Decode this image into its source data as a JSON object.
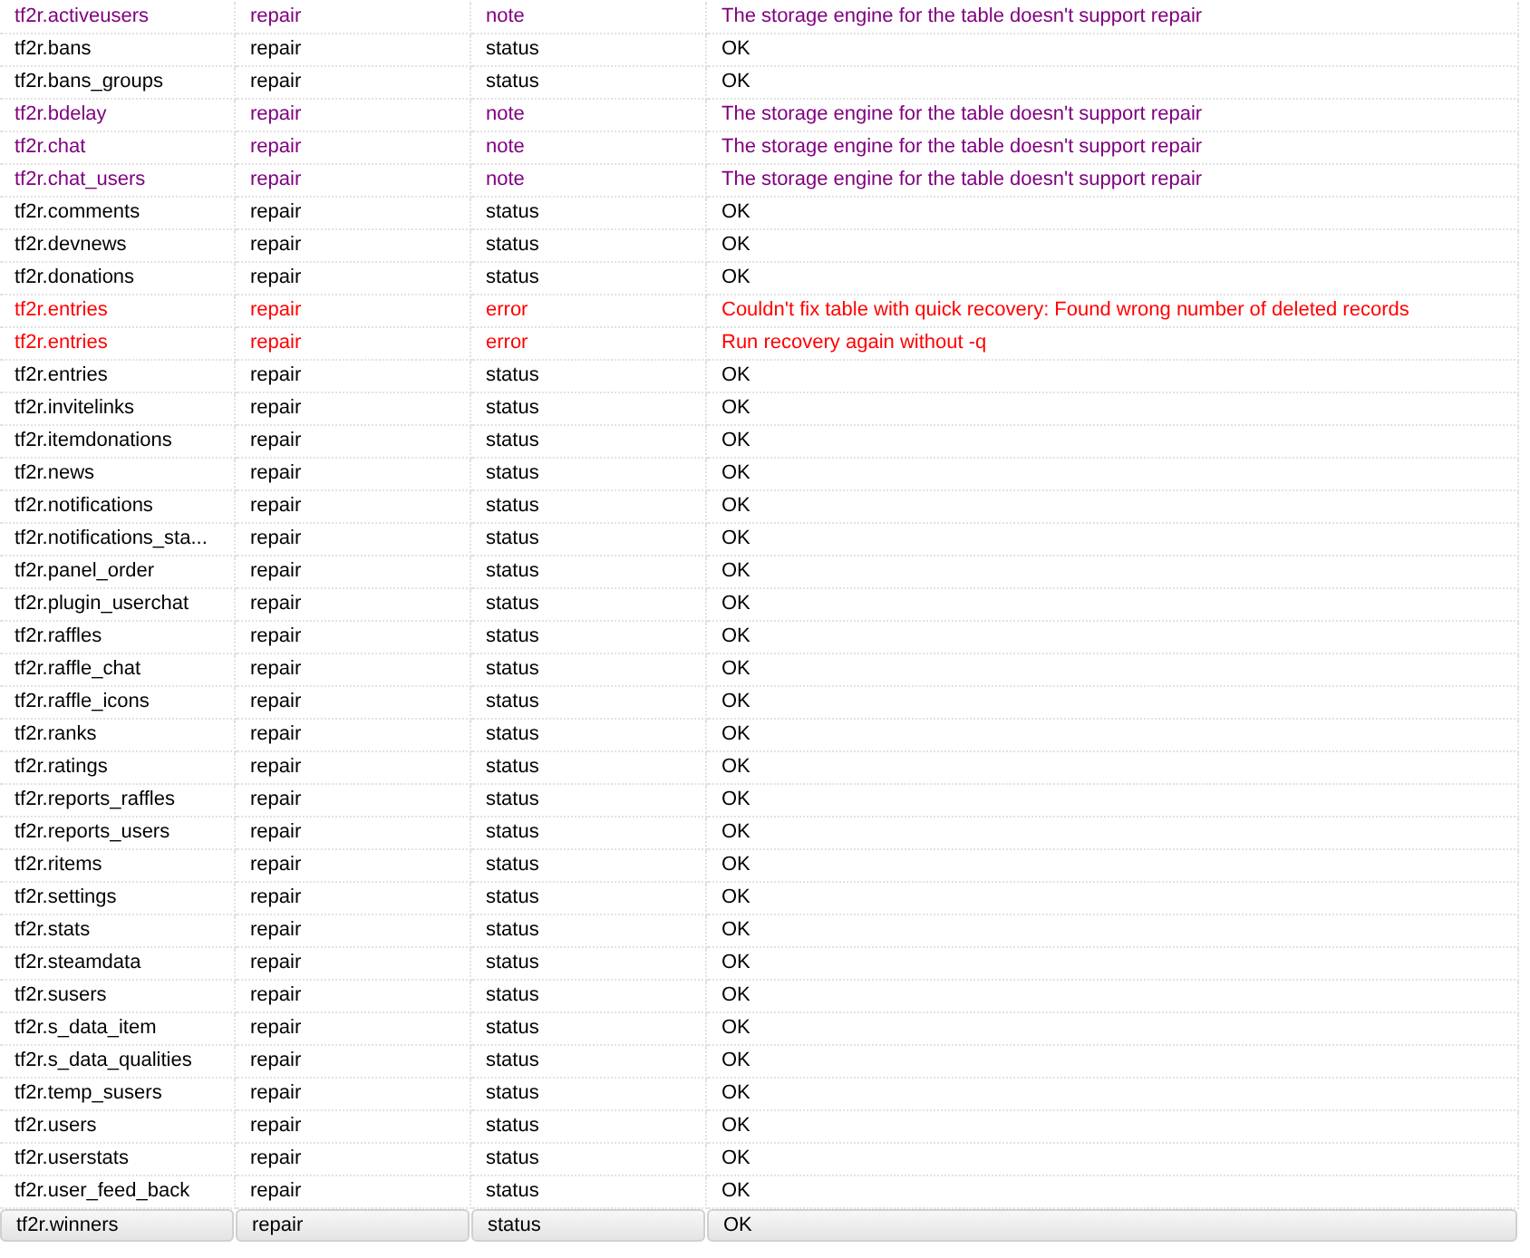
{
  "table": {
    "rows": [
      {
        "kind": "note",
        "selected": false,
        "cells": [
          "tf2r.activeusers",
          "repair",
          "note",
          "The storage engine for the table doesn't support repair"
        ]
      },
      {
        "kind": "status",
        "selected": false,
        "cells": [
          "tf2r.bans",
          "repair",
          "status",
          "OK"
        ]
      },
      {
        "kind": "status",
        "selected": false,
        "cells": [
          "tf2r.bans_groups",
          "repair",
          "status",
          "OK"
        ]
      },
      {
        "kind": "note",
        "selected": false,
        "cells": [
          "tf2r.bdelay",
          "repair",
          "note",
          "The storage engine for the table doesn't support repair"
        ]
      },
      {
        "kind": "note",
        "selected": false,
        "cells": [
          "tf2r.chat",
          "repair",
          "note",
          "The storage engine for the table doesn't support repair"
        ]
      },
      {
        "kind": "note",
        "selected": false,
        "cells": [
          "tf2r.chat_users",
          "repair",
          "note",
          "The storage engine for the table doesn't support repair"
        ]
      },
      {
        "kind": "status",
        "selected": false,
        "cells": [
          "tf2r.comments",
          "repair",
          "status",
          "OK"
        ]
      },
      {
        "kind": "status",
        "selected": false,
        "cells": [
          "tf2r.devnews",
          "repair",
          "status",
          "OK"
        ]
      },
      {
        "kind": "status",
        "selected": false,
        "cells": [
          "tf2r.donations",
          "repair",
          "status",
          "OK"
        ]
      },
      {
        "kind": "error",
        "selected": false,
        "cells": [
          "tf2r.entries",
          "repair",
          "error",
          "Couldn't fix table with quick recovery: Found wrong number of deleted records"
        ]
      },
      {
        "kind": "error",
        "selected": false,
        "cells": [
          "tf2r.entries",
          "repair",
          "error",
          "Run recovery again without -q"
        ]
      },
      {
        "kind": "status",
        "selected": false,
        "cells": [
          "tf2r.entries",
          "repair",
          "status",
          "OK"
        ]
      },
      {
        "kind": "status",
        "selected": false,
        "cells": [
          "tf2r.invitelinks",
          "repair",
          "status",
          "OK"
        ]
      },
      {
        "kind": "status",
        "selected": false,
        "cells": [
          "tf2r.itemdonations",
          "repair",
          "status",
          "OK"
        ]
      },
      {
        "kind": "status",
        "selected": false,
        "cells": [
          "tf2r.news",
          "repair",
          "status",
          "OK"
        ]
      },
      {
        "kind": "status",
        "selected": false,
        "cells": [
          "tf2r.notifications",
          "repair",
          "status",
          "OK"
        ]
      },
      {
        "kind": "status",
        "selected": false,
        "cells": [
          "tf2r.notifications_sta...",
          "repair",
          "status",
          "OK"
        ]
      },
      {
        "kind": "status",
        "selected": false,
        "cells": [
          "tf2r.panel_order",
          "repair",
          "status",
          "OK"
        ]
      },
      {
        "kind": "status",
        "selected": false,
        "cells": [
          "tf2r.plugin_userchat",
          "repair",
          "status",
          "OK"
        ]
      },
      {
        "kind": "status",
        "selected": false,
        "cells": [
          "tf2r.raffles",
          "repair",
          "status",
          "OK"
        ]
      },
      {
        "kind": "status",
        "selected": false,
        "cells": [
          "tf2r.raffle_chat",
          "repair",
          "status",
          "OK"
        ]
      },
      {
        "kind": "status",
        "selected": false,
        "cells": [
          "tf2r.raffle_icons",
          "repair",
          "status",
          "OK"
        ]
      },
      {
        "kind": "status",
        "selected": false,
        "cells": [
          "tf2r.ranks",
          "repair",
          "status",
          "OK"
        ]
      },
      {
        "kind": "status",
        "selected": false,
        "cells": [
          "tf2r.ratings",
          "repair",
          "status",
          "OK"
        ]
      },
      {
        "kind": "status",
        "selected": false,
        "cells": [
          "tf2r.reports_raffles",
          "repair",
          "status",
          "OK"
        ]
      },
      {
        "kind": "status",
        "selected": false,
        "cells": [
          "tf2r.reports_users",
          "repair",
          "status",
          "OK"
        ]
      },
      {
        "kind": "status",
        "selected": false,
        "cells": [
          "tf2r.ritems",
          "repair",
          "status",
          "OK"
        ]
      },
      {
        "kind": "status",
        "selected": false,
        "cells": [
          "tf2r.settings",
          "repair",
          "status",
          "OK"
        ]
      },
      {
        "kind": "status",
        "selected": false,
        "cells": [
          "tf2r.stats",
          "repair",
          "status",
          "OK"
        ]
      },
      {
        "kind": "status",
        "selected": false,
        "cells": [
          "tf2r.steamdata",
          "repair",
          "status",
          "OK"
        ]
      },
      {
        "kind": "status",
        "selected": false,
        "cells": [
          "tf2r.susers",
          "repair",
          "status",
          "OK"
        ]
      },
      {
        "kind": "status",
        "selected": false,
        "cells": [
          "tf2r.s_data_item",
          "repair",
          "status",
          "OK"
        ]
      },
      {
        "kind": "status",
        "selected": false,
        "cells": [
          "tf2r.s_data_qualities",
          "repair",
          "status",
          "OK"
        ]
      },
      {
        "kind": "status",
        "selected": false,
        "cells": [
          "tf2r.temp_susers",
          "repair",
          "status",
          "OK"
        ]
      },
      {
        "kind": "status",
        "selected": false,
        "cells": [
          "tf2r.users",
          "repair",
          "status",
          "OK"
        ]
      },
      {
        "kind": "status",
        "selected": false,
        "cells": [
          "tf2r.userstats",
          "repair",
          "status",
          "OK"
        ]
      },
      {
        "kind": "status",
        "selected": false,
        "cells": [
          "tf2r.user_feed_back",
          "repair",
          "status",
          "OK"
        ]
      },
      {
        "kind": "status",
        "selected": true,
        "cells": [
          "tf2r.winners",
          "repair",
          "status",
          "OK"
        ]
      }
    ]
  }
}
